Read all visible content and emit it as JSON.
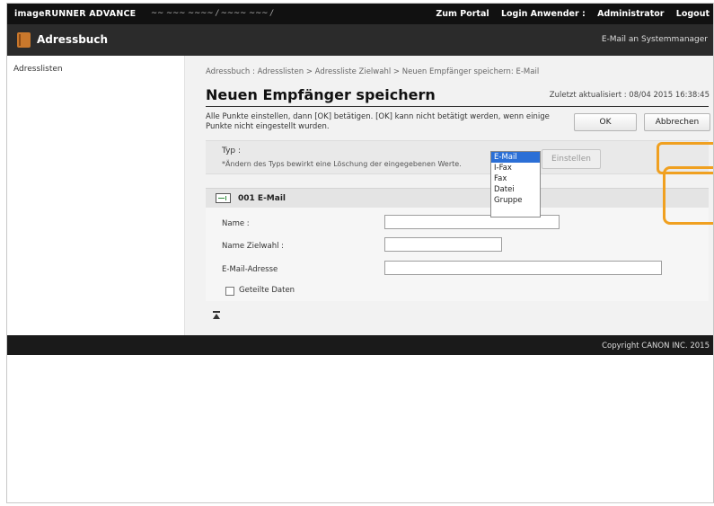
{
  "topbar": {
    "brand": "imageRUNNER ADVANCE",
    "device_name": "~~ ~~~ ~~~~ / ~~~~ ~~~ /",
    "links": [
      "Zum Portal",
      "Login Anwender :",
      "Administrator",
      "Logout"
    ]
  },
  "appbar": {
    "title": "Adressbuch",
    "book_icon": "address-book-icon",
    "mail_link": "E-Mail an Systemmanager"
  },
  "sidebar": {
    "items": [
      "Adresslisten"
    ]
  },
  "main": {
    "breadcrumb": "Adressbuch : Adresslisten > Adressliste Zielwahl > Neuen Empfänger speichern: E-Mail",
    "title": "Neuen Empfänger speichern",
    "updated": "Zuletzt aktualisiert : 08/04 2015 16:38:45",
    "instruction": "Alle Punkte einstellen, dann [OK] betätigen. [OK] kann nicht betätigt werden, wenn einige Punkte nicht eingestellt wurden.",
    "ok_label": "OK",
    "cancel_label": "Abbrechen",
    "type_label": "Typ :",
    "type_note": "*Ändern des Typs bewirkt eine Löschung der eingegebenen Werte.",
    "type_options": [
      "E-Mail",
      "I-Fax",
      "Fax",
      "Datei",
      "Gruppe"
    ],
    "type_selected": "E-Mail",
    "set_label": "Einstellen",
    "highlight_color": "#f0a020",
    "address_header": "001 E-Mail",
    "fields": {
      "name_label": "Name :",
      "zielwahl_label": "Name Zielwahl :",
      "email_label": "E-Mail-Adresse",
      "name_value": "",
      "zielwahl_value": "",
      "email_value": ""
    },
    "shared_label": "Geteilte Daten",
    "shared_checked": false
  },
  "footer": {
    "copyright": "Copyright CANON INC. 2015"
  },
  "colors": {
    "topbar": "#111111",
    "appbar": "#2b2b2b",
    "selection": "#2b6fd6",
    "book": "#c9782c"
  }
}
